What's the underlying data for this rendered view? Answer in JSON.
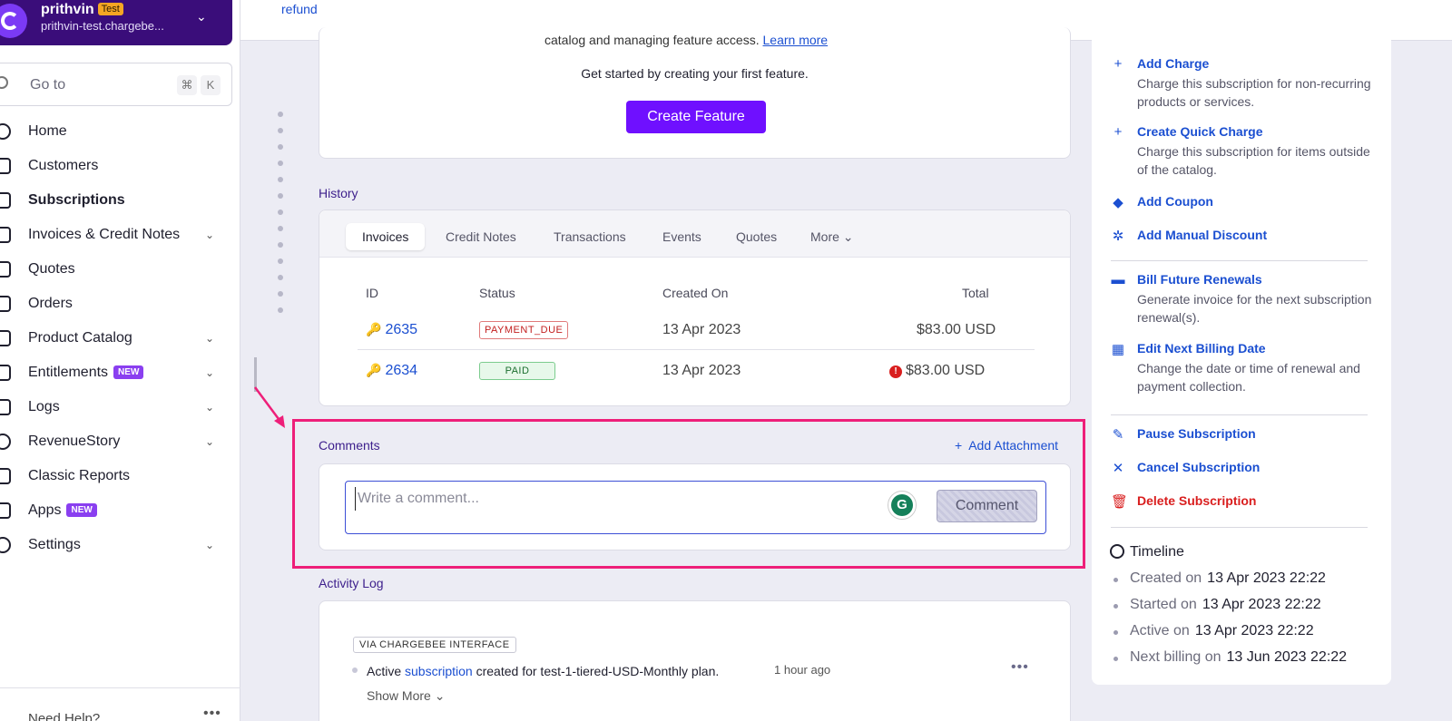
{
  "org": {
    "name": "prithvin",
    "badge": "Test",
    "site": "prithvin-test.chargebe..."
  },
  "goto": {
    "placeholder": "Go to",
    "key1": "⌘",
    "key2": "K"
  },
  "nav": [
    {
      "label": "Home"
    },
    {
      "label": "Customers"
    },
    {
      "label": "Subscriptions"
    },
    {
      "label": "Invoices & Credit Notes"
    },
    {
      "label": "Quotes"
    },
    {
      "label": "Orders"
    },
    {
      "label": "Product Catalog"
    },
    {
      "label": "Entitlements",
      "badge": "NEW"
    },
    {
      "label": "Logs"
    },
    {
      "label": "RevenueStory"
    },
    {
      "label": "Classic Reports"
    },
    {
      "label": "Apps",
      "badge": "NEW"
    },
    {
      "label": "Settings"
    }
  ],
  "need_help": "Need Help?",
  "topbar": {
    "refund": "refund"
  },
  "feature": {
    "cut_text": "catalog and managing feature access.",
    "learn_more": "Learn more",
    "subtitle": "Get started by creating your first feature.",
    "button": "Create Feature"
  },
  "history": {
    "title": "History",
    "tabs": [
      "Invoices",
      "Credit Notes",
      "Transactions",
      "Events",
      "Quotes",
      "More"
    ],
    "columns": [
      "ID",
      "Status",
      "Created On",
      "Total"
    ],
    "rows": [
      {
        "id": "2635",
        "status": "PAYMENT_DUE",
        "created": "13 Apr 2023",
        "total": "$83.00 USD"
      },
      {
        "id": "2634",
        "status": "PAID",
        "created": "13 Apr 2023",
        "total": "$83.00 USD"
      }
    ]
  },
  "comments": {
    "title": "Comments",
    "add_attachment": "Add Attachment",
    "placeholder": "Write a comment...",
    "button": "Comment",
    "grammarly": "G"
  },
  "activity": {
    "title": "Activity Log",
    "via": "VIA CHARGEBEE INTERFACE",
    "text_before": "Active",
    "link": "subscription",
    "text_after": "created for test-1-tiered-USD-Monthly plan.",
    "time": "1 hour ago",
    "show_more": "Show More"
  },
  "actions": [
    {
      "title": "Add Charge",
      "desc": "Charge this subscription for non-recurring products or services."
    },
    {
      "title": "Create Quick Charge",
      "desc": "Charge this subscription for items outside of the catalog."
    },
    {
      "title": "Add Coupon"
    },
    {
      "title": "Add Manual Discount"
    },
    {
      "title": "Bill Future Renewals",
      "desc": "Generate invoice for the next subscription renewal(s)."
    },
    {
      "title": "Edit Next Billing Date",
      "desc": "Change the date or time of renewal and payment collection."
    },
    {
      "title": "Pause Subscription"
    },
    {
      "title": "Cancel Subscription"
    },
    {
      "title": "Delete Subscription"
    }
  ],
  "timeline": {
    "title": "Timeline",
    "items": [
      {
        "label": "Created on",
        "value": "13 Apr 2023 22:22"
      },
      {
        "label": "Started on",
        "value": "13 Apr 2023 22:22"
      },
      {
        "label": "Active on",
        "value": "13 Apr 2023 22:22"
      },
      {
        "label": "Next billing on",
        "value": "13 Jun 2023 22:22"
      }
    ]
  },
  "colors": {
    "brand": "#6f10ff",
    "org_bg": "#3a0d7a",
    "link": "#1b4fd1",
    "highlight": "#ee1f79",
    "danger": "#d91e1e"
  }
}
